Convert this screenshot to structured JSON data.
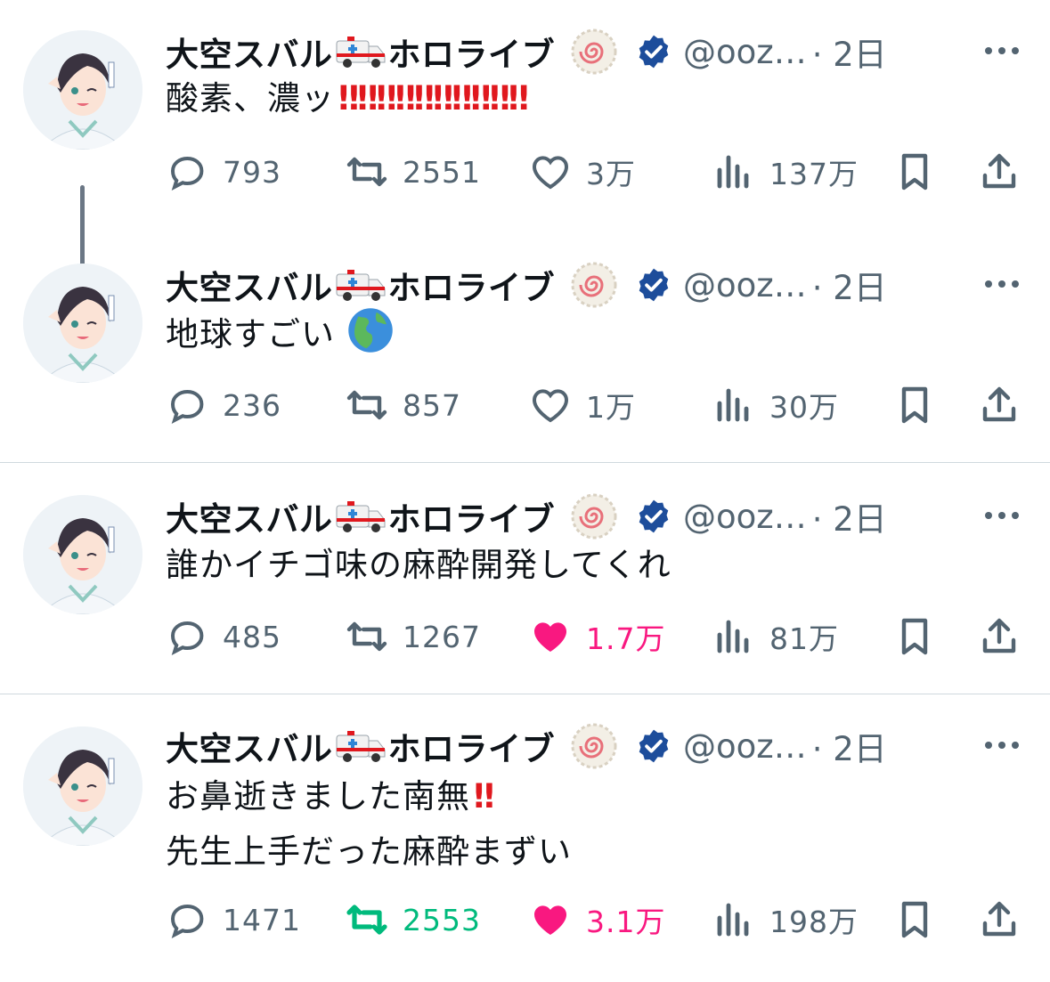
{
  "tweets": [
    {
      "name": "大空スバル",
      "name_suffix": "ホロライブ",
      "handle": "@ooz…",
      "time": "· 2日",
      "lines": [
        "酸素、濃ッ"
      ],
      "bangs": "‼‼‼‼‼‼‼‼‼‼",
      "replies": "793",
      "retweets": "2551",
      "likes": "3万",
      "views": "137万",
      "liked": false,
      "retweeted": false
    },
    {
      "name": "大空スバル",
      "name_suffix": "ホロライブ",
      "handle": "@ooz…",
      "time": "· 2日",
      "lines": [
        "地球すごい"
      ],
      "replies": "236",
      "retweets": "857",
      "likes": "1万",
      "views": "30万",
      "liked": false,
      "retweeted": false
    },
    {
      "name": "大空スバル",
      "name_suffix": "ホロライブ",
      "handle": "@ooz…",
      "time": "· 2日",
      "lines": [
        "誰かイチゴ味の麻酔開発してくれ"
      ],
      "replies": "485",
      "retweets": "1267",
      "likes": "1.7万",
      "views": "81万",
      "liked": true,
      "retweeted": false
    },
    {
      "name": "大空スバル",
      "name_suffix": "ホロライブ",
      "handle": "@ooz…",
      "time": "· 2日",
      "lines": [
        "お鼻逝きました南無",
        "先生上手だった麻酔まずい"
      ],
      "line1_bang": "‼",
      "replies": "1471",
      "retweets": "2553",
      "likes": "3.1万",
      "views": "198万",
      "liked": true,
      "retweeted": true
    }
  ],
  "colors": {
    "text": "#0f1419",
    "muted": "#536471",
    "like": "#f91880",
    "retweet": "#00ba7c",
    "verified": "#1d4d9b",
    "bang": "#e0181e",
    "divider": "#cfd9de"
  },
  "icons": [
    "reply-icon",
    "retweet-icon",
    "like-icon",
    "views-icon",
    "bookmark-icon",
    "share-icon",
    "more-icon",
    "verified-icon",
    "ambulance-emoji",
    "naruto-badge-icon",
    "globe-emoji"
  ]
}
